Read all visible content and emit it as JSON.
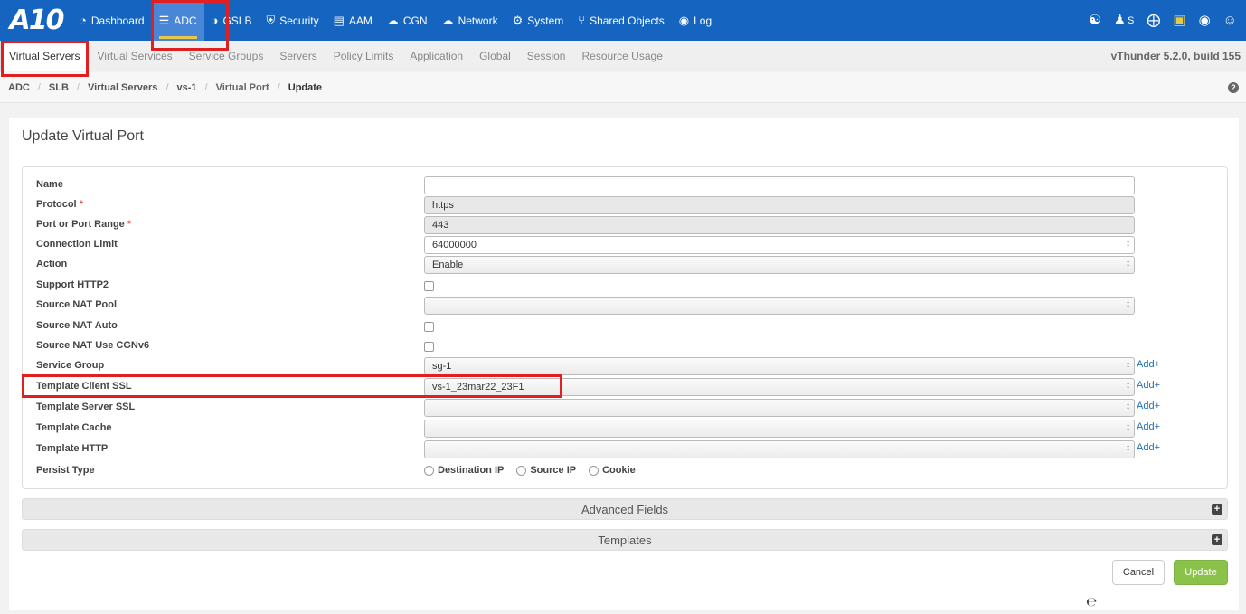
{
  "logo": "A10",
  "nav": {
    "items": [
      {
        "label": "Dashboard",
        "icon": "dashboard-icon",
        "glyph": "◔"
      },
      {
        "label": "ADC",
        "icon": "list-icon",
        "glyph": "☰"
      },
      {
        "label": "GSLB",
        "icon": "globe-icon",
        "glyph": "◑"
      },
      {
        "label": "Security",
        "icon": "shield-icon",
        "glyph": "⛨"
      },
      {
        "label": "AAM",
        "icon": "id-card-icon",
        "glyph": "▤"
      },
      {
        "label": "CGN",
        "icon": "cloud-icon",
        "glyph": "☁"
      },
      {
        "label": "Network",
        "icon": "cloud-network-icon",
        "glyph": "☁"
      },
      {
        "label": "System",
        "icon": "gear-icon",
        "glyph": "⚙"
      },
      {
        "label": "Shared Objects",
        "icon": "share-icon",
        "glyph": "⑂"
      },
      {
        "label": "Log",
        "icon": "eye-icon",
        "glyph": "◉"
      }
    ],
    "user_text": "S"
  },
  "subnav": {
    "items": [
      "Virtual Servers",
      "Virtual Services",
      "Service Groups",
      "Servers",
      "Policy Limits",
      "Application",
      "Global",
      "Session",
      "Resource Usage"
    ],
    "version": "vThunder 5.2.0, build 155"
  },
  "breadcrumb": [
    "ADC",
    "SLB",
    "Virtual Servers",
    "vs-1",
    "Virtual Port",
    "Update"
  ],
  "page_title": "Update Virtual Port",
  "form": {
    "name": {
      "label": "Name",
      "value": ""
    },
    "protocol": {
      "label": "Protocol",
      "value": "https"
    },
    "port": {
      "label": "Port or Port Range",
      "value": "443"
    },
    "conn_limit": {
      "label": "Connection Limit",
      "value": "64000000"
    },
    "action": {
      "label": "Action",
      "value": "Enable"
    },
    "http2": {
      "label": "Support HTTP2"
    },
    "snat_pool": {
      "label": "Source NAT Pool",
      "value": ""
    },
    "snat_auto": {
      "label": "Source NAT Auto"
    },
    "snat_cgnv6": {
      "label": "Source NAT Use CGNv6"
    },
    "service_group": {
      "label": "Service Group",
      "value": "sg-1"
    },
    "tpl_client_ssl": {
      "label": "Template Client SSL",
      "value": "vs-1_23mar22_23F1"
    },
    "tpl_server_ssl": {
      "label": "Template Server SSL",
      "value": ""
    },
    "tpl_cache": {
      "label": "Template Cache",
      "value": ""
    },
    "tpl_http": {
      "label": "Template HTTP",
      "value": ""
    },
    "persist": {
      "label": "Persist Type",
      "options": [
        "Destination IP",
        "Source IP",
        "Cookie"
      ]
    },
    "add_label": "Add+",
    "required_mark": "*"
  },
  "sections": {
    "advanced": "Advanced Fields",
    "templates": "Templates"
  },
  "buttons": {
    "cancel": "Cancel",
    "update": "Update"
  },
  "colors": {
    "nav_bg": "#1565c0",
    "highlight": "#e02020",
    "update_btn": "#8bc34a",
    "link": "#1e6fb8"
  }
}
